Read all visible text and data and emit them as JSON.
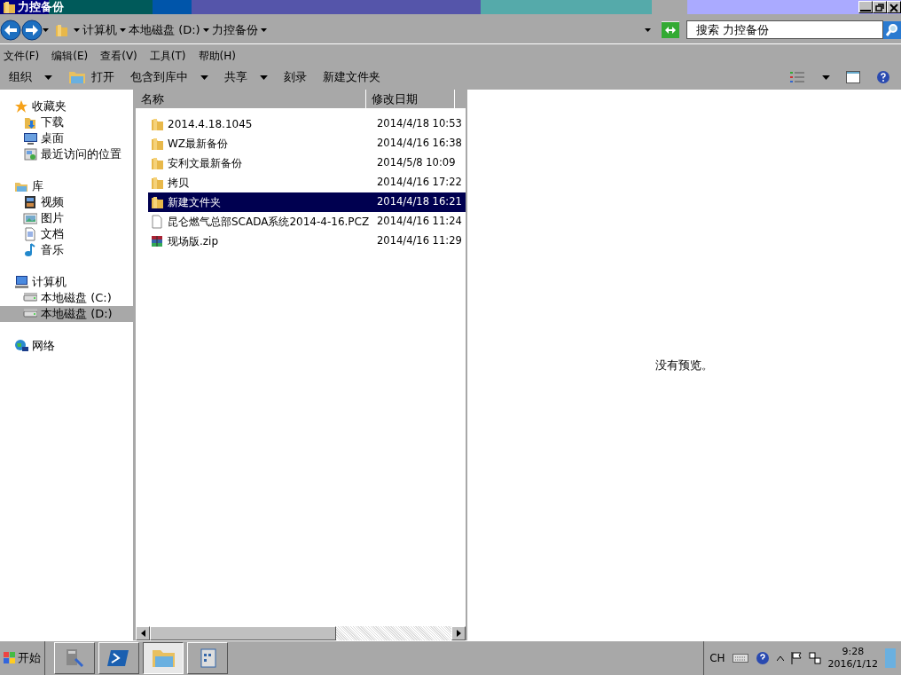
{
  "window": {
    "title": "力控备份"
  },
  "address": {
    "crumbs": [
      "计算机",
      "本地磁盘 (D:)",
      "力控备份"
    ]
  },
  "search": {
    "placeholder": "搜索 力控备份"
  },
  "menu": [
    "文件(F)",
    "编辑(E)",
    "查看(V)",
    "工具(T)",
    "帮助(H)"
  ],
  "toolbar": [
    {
      "label": "组织",
      "dropdown": true,
      "icon": false
    },
    {
      "label": "打开",
      "dropdown": false,
      "icon": true
    },
    {
      "label": "包含到库中",
      "dropdown": true,
      "icon": false
    },
    {
      "label": "共享",
      "dropdown": true,
      "icon": false
    },
    {
      "label": "刻录",
      "dropdown": false,
      "icon": false
    },
    {
      "label": "新建文件夹",
      "dropdown": false,
      "icon": false
    }
  ],
  "sidebar": {
    "groups": [
      {
        "label": "收藏夹",
        "kind": "star",
        "children": [
          {
            "label": "下载",
            "kind": "download",
            "selected": false
          },
          {
            "label": "桌面",
            "kind": "desktop",
            "selected": false
          },
          {
            "label": "最近访问的位置",
            "kind": "recent",
            "selected": false
          }
        ]
      },
      {
        "label": "库",
        "kind": "library",
        "children": [
          {
            "label": "视频",
            "kind": "video",
            "selected": false
          },
          {
            "label": "图片",
            "kind": "image",
            "selected": false
          },
          {
            "label": "文档",
            "kind": "document",
            "selected": false
          },
          {
            "label": "音乐",
            "kind": "music",
            "selected": false
          }
        ]
      },
      {
        "label": "计算机",
        "kind": "computer",
        "children": [
          {
            "label": "本地磁盘 (C:)",
            "kind": "drive",
            "selected": false
          },
          {
            "label": "本地磁盘 (D:)",
            "kind": "drive",
            "selected": true
          }
        ]
      },
      {
        "label": "网络",
        "kind": "network"
      }
    ]
  },
  "table": {
    "columns": [
      "名称",
      "修改日期"
    ],
    "rows": [
      {
        "name": "2014.4.18.1045",
        "date": "2014/4/18 10:53",
        "kind": "folder",
        "selected": false
      },
      {
        "name": "WZ最新备份",
        "date": "2014/4/16 16:38",
        "kind": "folder",
        "selected": false
      },
      {
        "name": "安利文最新备份",
        "date": "2014/5/8 10:09",
        "kind": "folder",
        "selected": false
      },
      {
        "name": "拷贝",
        "date": "2014/4/16 17:22",
        "kind": "folder",
        "selected": false
      },
      {
        "name": "新建文件夹",
        "date": "2014/4/18 16:21",
        "kind": "folder",
        "selected": true
      },
      {
        "name": "昆仑燃气总部SCADA系统2014-4-16.PCZ",
        "date": "2014/4/16 11:24",
        "kind": "file",
        "selected": false
      },
      {
        "name": "现场版.zip",
        "date": "2014/4/16 11:29",
        "kind": "zip",
        "selected": false
      }
    ]
  },
  "preview": {
    "text": "没有预览。"
  },
  "taskbar": {
    "start": "开始",
    "apps": [
      {
        "kind": "server",
        "selected": false
      },
      {
        "kind": "powershell",
        "selected": false
      },
      {
        "kind": "explorer",
        "selected": true
      },
      {
        "kind": "panel",
        "selected": false
      }
    ],
    "language": "CH",
    "time": "9:28",
    "date": "2016/1/12"
  }
}
